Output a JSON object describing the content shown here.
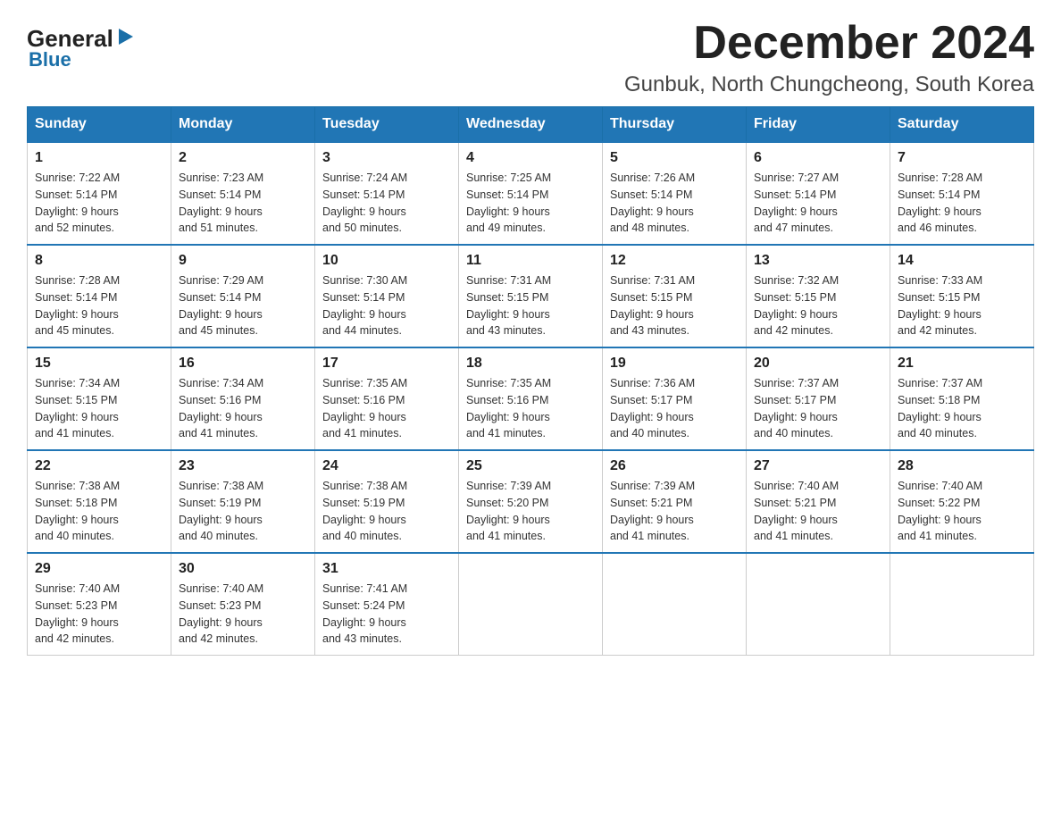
{
  "logo": {
    "top": "General",
    "arrow": "▶",
    "bottom": "Blue"
  },
  "title": "December 2024",
  "subtitle": "Gunbuk, North Chungcheong, South Korea",
  "days": [
    "Sunday",
    "Monday",
    "Tuesday",
    "Wednesday",
    "Thursday",
    "Friday",
    "Saturday"
  ],
  "weeks": [
    [
      {
        "num": "1",
        "info": "Sunrise: 7:22 AM\nSunset: 5:14 PM\nDaylight: 9 hours\nand 52 minutes."
      },
      {
        "num": "2",
        "info": "Sunrise: 7:23 AM\nSunset: 5:14 PM\nDaylight: 9 hours\nand 51 minutes."
      },
      {
        "num": "3",
        "info": "Sunrise: 7:24 AM\nSunset: 5:14 PM\nDaylight: 9 hours\nand 50 minutes."
      },
      {
        "num": "4",
        "info": "Sunrise: 7:25 AM\nSunset: 5:14 PM\nDaylight: 9 hours\nand 49 minutes."
      },
      {
        "num": "5",
        "info": "Sunrise: 7:26 AM\nSunset: 5:14 PM\nDaylight: 9 hours\nand 48 minutes."
      },
      {
        "num": "6",
        "info": "Sunrise: 7:27 AM\nSunset: 5:14 PM\nDaylight: 9 hours\nand 47 minutes."
      },
      {
        "num": "7",
        "info": "Sunrise: 7:28 AM\nSunset: 5:14 PM\nDaylight: 9 hours\nand 46 minutes."
      }
    ],
    [
      {
        "num": "8",
        "info": "Sunrise: 7:28 AM\nSunset: 5:14 PM\nDaylight: 9 hours\nand 45 minutes."
      },
      {
        "num": "9",
        "info": "Sunrise: 7:29 AM\nSunset: 5:14 PM\nDaylight: 9 hours\nand 45 minutes."
      },
      {
        "num": "10",
        "info": "Sunrise: 7:30 AM\nSunset: 5:14 PM\nDaylight: 9 hours\nand 44 minutes."
      },
      {
        "num": "11",
        "info": "Sunrise: 7:31 AM\nSunset: 5:15 PM\nDaylight: 9 hours\nand 43 minutes."
      },
      {
        "num": "12",
        "info": "Sunrise: 7:31 AM\nSunset: 5:15 PM\nDaylight: 9 hours\nand 43 minutes."
      },
      {
        "num": "13",
        "info": "Sunrise: 7:32 AM\nSunset: 5:15 PM\nDaylight: 9 hours\nand 42 minutes."
      },
      {
        "num": "14",
        "info": "Sunrise: 7:33 AM\nSunset: 5:15 PM\nDaylight: 9 hours\nand 42 minutes."
      }
    ],
    [
      {
        "num": "15",
        "info": "Sunrise: 7:34 AM\nSunset: 5:15 PM\nDaylight: 9 hours\nand 41 minutes."
      },
      {
        "num": "16",
        "info": "Sunrise: 7:34 AM\nSunset: 5:16 PM\nDaylight: 9 hours\nand 41 minutes."
      },
      {
        "num": "17",
        "info": "Sunrise: 7:35 AM\nSunset: 5:16 PM\nDaylight: 9 hours\nand 41 minutes."
      },
      {
        "num": "18",
        "info": "Sunrise: 7:35 AM\nSunset: 5:16 PM\nDaylight: 9 hours\nand 41 minutes."
      },
      {
        "num": "19",
        "info": "Sunrise: 7:36 AM\nSunset: 5:17 PM\nDaylight: 9 hours\nand 40 minutes."
      },
      {
        "num": "20",
        "info": "Sunrise: 7:37 AM\nSunset: 5:17 PM\nDaylight: 9 hours\nand 40 minutes."
      },
      {
        "num": "21",
        "info": "Sunrise: 7:37 AM\nSunset: 5:18 PM\nDaylight: 9 hours\nand 40 minutes."
      }
    ],
    [
      {
        "num": "22",
        "info": "Sunrise: 7:38 AM\nSunset: 5:18 PM\nDaylight: 9 hours\nand 40 minutes."
      },
      {
        "num": "23",
        "info": "Sunrise: 7:38 AM\nSunset: 5:19 PM\nDaylight: 9 hours\nand 40 minutes."
      },
      {
        "num": "24",
        "info": "Sunrise: 7:38 AM\nSunset: 5:19 PM\nDaylight: 9 hours\nand 40 minutes."
      },
      {
        "num": "25",
        "info": "Sunrise: 7:39 AM\nSunset: 5:20 PM\nDaylight: 9 hours\nand 41 minutes."
      },
      {
        "num": "26",
        "info": "Sunrise: 7:39 AM\nSunset: 5:21 PM\nDaylight: 9 hours\nand 41 minutes."
      },
      {
        "num": "27",
        "info": "Sunrise: 7:40 AM\nSunset: 5:21 PM\nDaylight: 9 hours\nand 41 minutes."
      },
      {
        "num": "28",
        "info": "Sunrise: 7:40 AM\nSunset: 5:22 PM\nDaylight: 9 hours\nand 41 minutes."
      }
    ],
    [
      {
        "num": "29",
        "info": "Sunrise: 7:40 AM\nSunset: 5:23 PM\nDaylight: 9 hours\nand 42 minutes."
      },
      {
        "num": "30",
        "info": "Sunrise: 7:40 AM\nSunset: 5:23 PM\nDaylight: 9 hours\nand 42 minutes."
      },
      {
        "num": "31",
        "info": "Sunrise: 7:41 AM\nSunset: 5:24 PM\nDaylight: 9 hours\nand 43 minutes."
      },
      null,
      null,
      null,
      null
    ]
  ]
}
